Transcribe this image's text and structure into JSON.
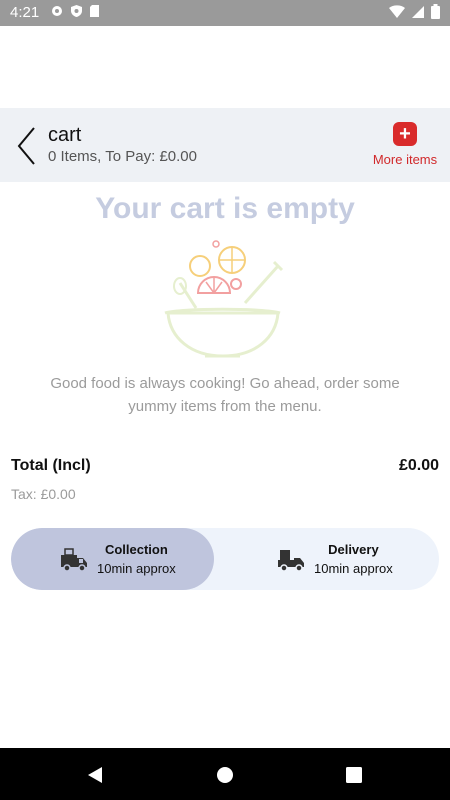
{
  "status_bar": {
    "time": "4:21",
    "icons": [
      "gear-icon",
      "shield-icon",
      "sd-card-icon",
      "wifi-icon",
      "signal-icon",
      "battery-icon"
    ]
  },
  "header": {
    "title": "cart",
    "subtitle": "0 Items, To Pay: £0.00",
    "more_items_label": "More items"
  },
  "empty_state": {
    "title": "Your cart is empty",
    "message": "Good food is always cooking! Go ahead, order some yummy items from the menu."
  },
  "totals": {
    "total_label": "Total (Incl)",
    "total_value": "£0.00",
    "tax": "Tax: £0.00"
  },
  "order_modes": [
    {
      "title": "Collection",
      "subtitle": "10min approx",
      "selected": true
    },
    {
      "title": "Delivery",
      "subtitle": "10min approx",
      "selected": false
    }
  ],
  "colors": {
    "accent_red": "#d92b2b",
    "empty_title": "#c5cce0",
    "selected_mode": "#bfc5dd",
    "toggle_bg": "#eef3fb"
  }
}
